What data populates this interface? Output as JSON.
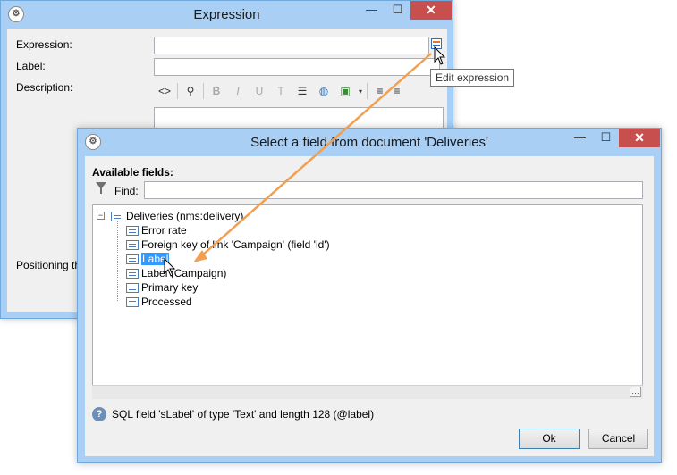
{
  "expression_dialog": {
    "title": "Expression",
    "app_icon": "ae-logo",
    "close_symbol": "✕",
    "minimize_symbol": "—",
    "maximize_symbol": "☐",
    "fields": {
      "expression_label": "Expression:",
      "label_label": "Label:",
      "description_label": "Description:",
      "expression_value": "",
      "label_value": ""
    },
    "positioning_label": "Positioning th",
    "toolbar": {
      "bold": "B",
      "italic": "I",
      "underline": "U"
    },
    "edit_expression_tooltip": "Edit expression"
  },
  "field_dialog": {
    "title": "Select a field from document 'Deliveries'",
    "app_icon": "ae-logo",
    "available_fields_label": "Available fields:",
    "find_label": "Find:",
    "find_value": "",
    "tree": {
      "root": "Deliveries (nms:delivery)",
      "children": [
        "Error rate",
        "Foreign key of link 'Campaign' (field 'id')",
        "Label",
        "Label (Campaign)",
        "Primary key",
        "Processed"
      ],
      "selected": "Label"
    },
    "status_text": "SQL field 'sLabel' of type 'Text' and length 128 (@label)",
    "ok_label": "Ok",
    "cancel_label": "Cancel"
  },
  "colors": {
    "title_bar": "#a9cff5",
    "selection": "#3399ff",
    "arrow": "#f0a050",
    "close_button": "#c7504f"
  }
}
